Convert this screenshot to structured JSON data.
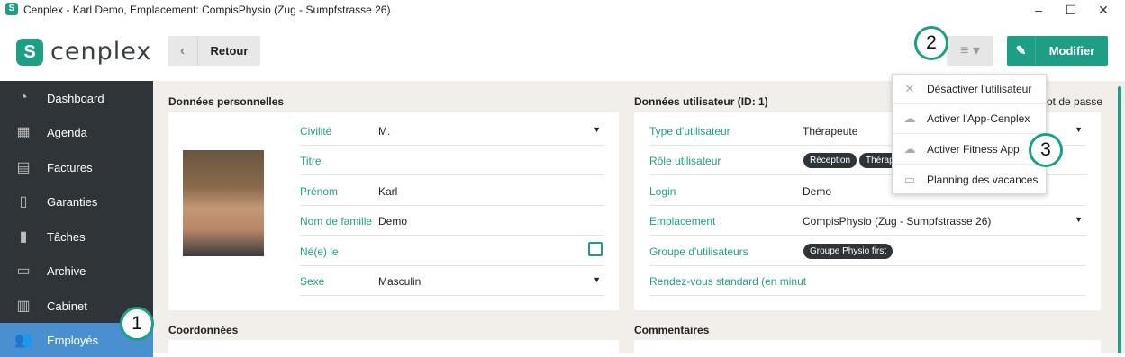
{
  "window": {
    "title": "Cenplex - Karl Demo, Emplacement: CompisPhysio (Zug - Sumpfstrasse 26)",
    "app_icon": "S",
    "minimize": "–",
    "maximize": "☐",
    "close": "✕"
  },
  "logo": {
    "mark": "S",
    "word": "cenplex"
  },
  "toolbar": {
    "back_label": "Retour",
    "back_icon": "‹",
    "menu_icon": "≡ ▾",
    "edit_label": "Modifier",
    "edit_icon": "✎"
  },
  "sidebar": {
    "items": [
      {
        "label": "Dashboard",
        "icon": "dashboard-icon",
        "glyph": "◔"
      },
      {
        "label": "Agenda",
        "icon": "calendar-icon",
        "glyph": "▦"
      },
      {
        "label": "Factures",
        "icon": "calculator-icon",
        "glyph": "▤"
      },
      {
        "label": "Garanties",
        "icon": "document-icon",
        "glyph": "▯"
      },
      {
        "label": "Tâches",
        "icon": "clipboard-icon",
        "glyph": "▮"
      },
      {
        "label": "Archive",
        "icon": "archive-icon",
        "glyph": "▭"
      },
      {
        "label": "Cabinet",
        "icon": "building-icon",
        "glyph": "▥"
      },
      {
        "label": "Employés",
        "icon": "people-icon",
        "glyph": "👥"
      }
    ]
  },
  "personal": {
    "title": "Données personnelles",
    "fields": [
      {
        "label": "Civilité",
        "value": "M."
      },
      {
        "label": "Titre",
        "value": ""
      },
      {
        "label": "Prénom",
        "value": "Karl"
      },
      {
        "label": "Nom de famille",
        "value": "Demo"
      },
      {
        "label": "Né(e) le",
        "value": ""
      },
      {
        "label": "Sexe",
        "value": "Masculin"
      }
    ]
  },
  "user": {
    "title": "Données utilisateur (ID: 1)",
    "password_hint": "ot de passe",
    "fields": [
      {
        "label": "Type d'utilisateur",
        "value": "Thérapeute"
      },
      {
        "label": "Rôle utilisateur",
        "value": ""
      },
      {
        "label": "Login",
        "value": "Demo"
      },
      {
        "label": "Emplacement",
        "value": "CompisPhysio (Zug - Sumpfstrasse 26)"
      },
      {
        "label": "Groupe d'utilisateurs",
        "value": ""
      },
      {
        "label": "Rendez-vous standard (en minut",
        "value": ""
      }
    ],
    "roles": [
      "Réception",
      "Thérap"
    ],
    "groups": [
      "Groupe Physio first"
    ]
  },
  "sections": {
    "contact": "Coordonnées",
    "comments": "Commentaires"
  },
  "menu": {
    "items": [
      {
        "label": "Désactiver l'utilisateur",
        "glyph": "✕"
      },
      {
        "label": "Activer l'App-Cenplex",
        "glyph": "☁"
      },
      {
        "label": "Activer Fitness App",
        "glyph": "☁"
      },
      {
        "label": "Planning des vacances",
        "glyph": "▭"
      }
    ]
  },
  "callouts": [
    "1",
    "2",
    "3"
  ],
  "colors": {
    "accent": "#1f9e86",
    "sidebar": "#2f3439",
    "active": "#4a8fcf",
    "background": "#f2efeb"
  }
}
